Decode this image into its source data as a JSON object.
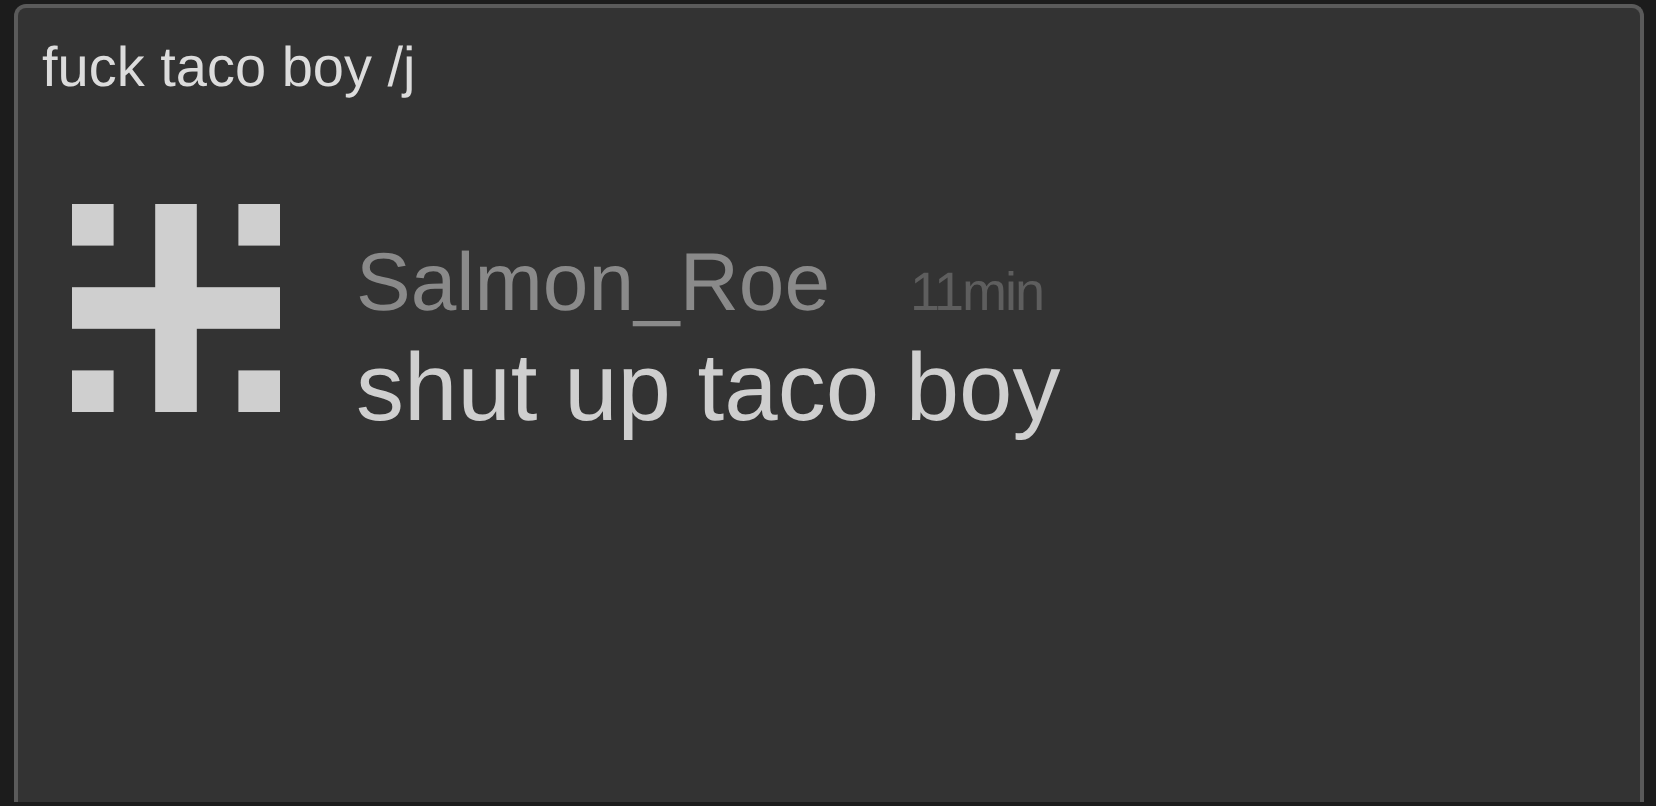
{
  "comment": {
    "text": "fuck taco boy /j",
    "message": {
      "username": "Salmon_Roe",
      "time": "11min",
      "body": "shut up taco boy"
    }
  }
}
